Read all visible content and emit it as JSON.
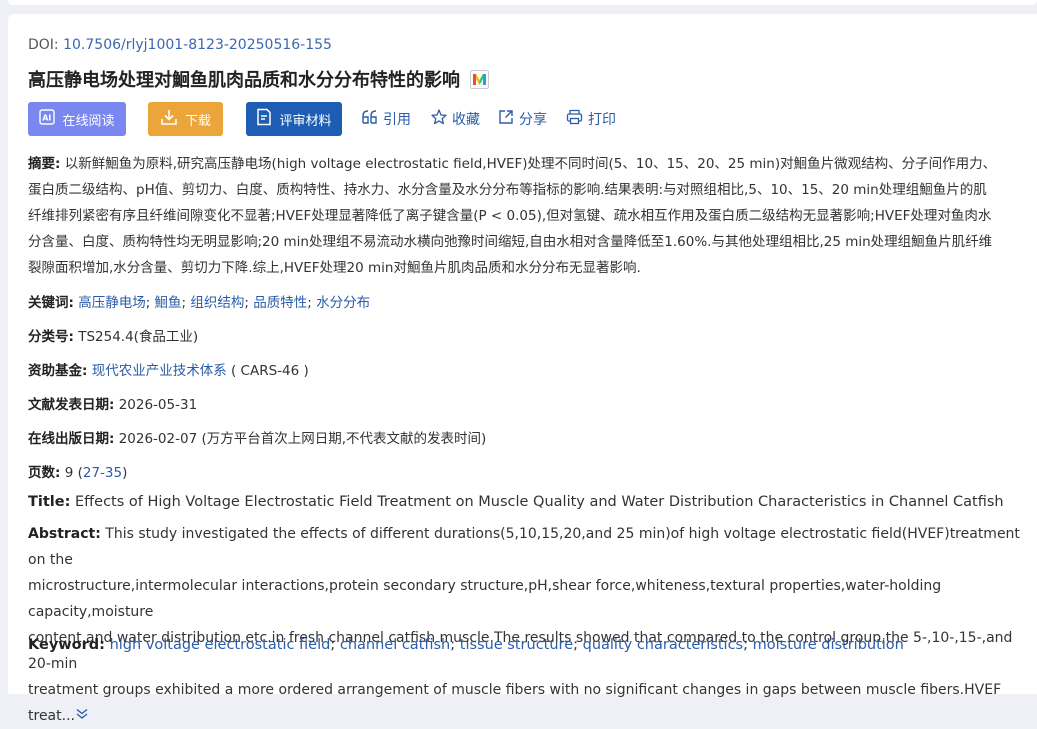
{
  "doi": {
    "label": "DOI:",
    "value": "10.7506/rlyj1001-8123-20250516-155"
  },
  "title": "高压静电场处理对鮰鱼肌肉品质和水分分布特性的影响",
  "title_badge": "M",
  "actions": {
    "read": "在线阅读",
    "download": "下载",
    "review": "评审材料",
    "cite": "引用",
    "favorite": "收藏",
    "share": "分享",
    "print": "打印"
  },
  "abstract_cn": {
    "label": "摘要:",
    "lines": [
      "以新鲜鮰鱼为原料,研究高压静电场(high voltage electrostatic field,HVEF)处理不同时间(5、10、15、20、25 min)对鮰鱼片微观结构、分子间作用力、",
      "蛋白质二级结构、pH值、剪切力、白度、质构特性、持水力、水分含量及水分分布等指标的影响.结果表明:与对照组相比,5、10、15、20 min处理组鮰鱼片的肌",
      "纤维排列紧密有序且纤维间隙变化不显著;HVEF处理显著降低了离子键含量(P < 0.05),但对氢键、疏水相互作用及蛋白质二级结构无显著影响;HVEF处理对鱼肉水",
      "分含量、白度、质构特性均无明显影响;20 min处理组不易流动水横向弛豫时间缩短,自由水相对含量降低至1.60%.与其他处理组相比,25 min处理组鮰鱼片肌纤维",
      "裂隙面积增加,水分含量、剪切力下降.综上,HVEF处理20 min对鮰鱼片肌肉品质和水分分布无显著影响."
    ]
  },
  "keywords_cn": {
    "label": "关键词:",
    "items": [
      "高压静电场",
      "鮰鱼",
      "组织结构",
      "品质特性",
      "水分分布"
    ]
  },
  "classification": {
    "label": "分类号:",
    "value": "TS254.4(食品工业)"
  },
  "fund": {
    "label": "资助基金:",
    "name": "现代农业产业技术体系",
    "code": "( CARS-46 )"
  },
  "pub_date": {
    "label": "文献发表日期:",
    "value": "2026-05-31"
  },
  "online_date": {
    "label": "在线出版日期:",
    "value": "2026-02-07",
    "note": "(万方平台首次上网日期,不代表文献的发表时间)"
  },
  "pages": {
    "label": "页数:",
    "count": "9",
    "range": "27-35"
  },
  "title_en": {
    "label": "Title:",
    "value": "Effects of High Voltage Electrostatic Field Treatment on Muscle Quality and Water Distribution Characteristics in Channel Catfish"
  },
  "abstract_en": {
    "label": "Abstract:",
    "lines": [
      "This study investigated the effects of different durations(5,10,15,20,and 25 min)of high voltage electrostatic field(HVEF)treatment on the",
      "microstructure,intermolecular interactions,protein secondary structure,pH,shear force,whiteness,textural properties,water-holding capacity,moisture",
      "content,and water distribution etc.in fresh channel catfish muscle.The results showed that compared to the control group,the 5-,10-,15-,and 20-min",
      "treatment groups exhibited a more ordered arrangement of muscle fibers with no significant changes in gaps between muscle fibers.HVEF treat..."
    ]
  },
  "keywords_en": {
    "label": "Keyword:",
    "items": [
      "high voltage electrostatic field",
      "channel catfish",
      "tissue structure",
      "quality characteristics",
      "moisture distribution"
    ]
  },
  "colors": {
    "link": "#2a5caa",
    "read_btn": "#7b87f0",
    "download_btn": "#eba53b",
    "review_btn": "#1d5db4"
  }
}
